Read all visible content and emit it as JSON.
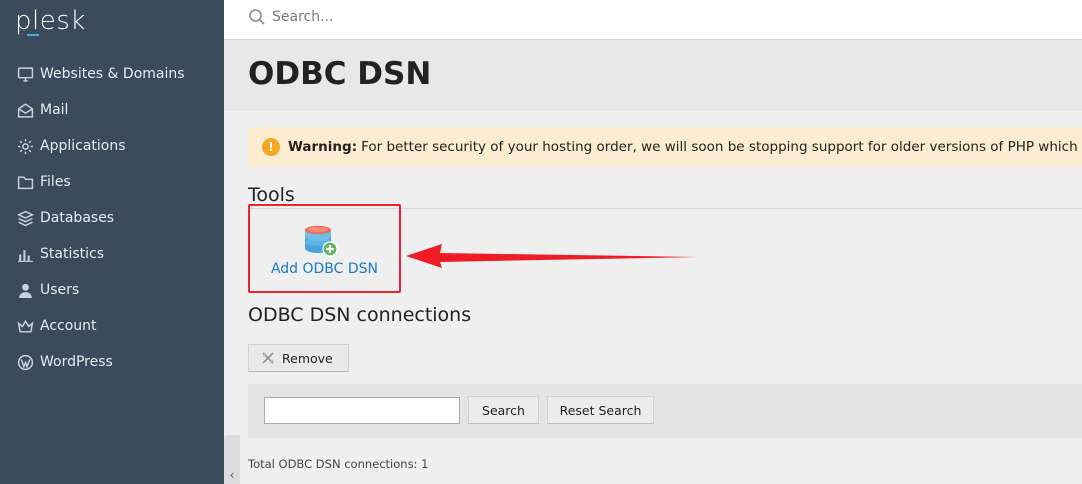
{
  "brand": {
    "logo_text": "plesk",
    "accent": "#39b0d8"
  },
  "sidebar": {
    "items": [
      {
        "label": "Websites & Domains",
        "icon": "monitor-icon"
      },
      {
        "label": "Mail",
        "icon": "envelope-icon"
      },
      {
        "label": "Applications",
        "icon": "gear-icon"
      },
      {
        "label": "Files",
        "icon": "folder-icon"
      },
      {
        "label": "Databases",
        "icon": "stack-icon"
      },
      {
        "label": "Statistics",
        "icon": "bar-chart-icon"
      },
      {
        "label": "Users",
        "icon": "user-icon"
      },
      {
        "label": "Account",
        "icon": "crown-icon"
      },
      {
        "label": "WordPress",
        "icon": "wordpress-icon"
      }
    ],
    "collapse_glyph": "‹"
  },
  "topbar": {
    "search_placeholder": "Search..."
  },
  "page": {
    "title": "ODBC DSN"
  },
  "warning": {
    "label": "Warning:",
    "text": "For better security of your hosting order, we will soon be stopping support for older versions of PHP which are n",
    "color": "#fcecd1"
  },
  "tools": {
    "heading": "Tools",
    "add_label": "Add ODBC DSN",
    "highlight_color": "#e8262b"
  },
  "connections": {
    "heading": "ODBC DSN connections",
    "remove_label": "Remove",
    "search_label": "Search",
    "reset_label": "Reset Search",
    "filter_value": "",
    "total_text": "Total ODBC DSN connections: 1"
  }
}
